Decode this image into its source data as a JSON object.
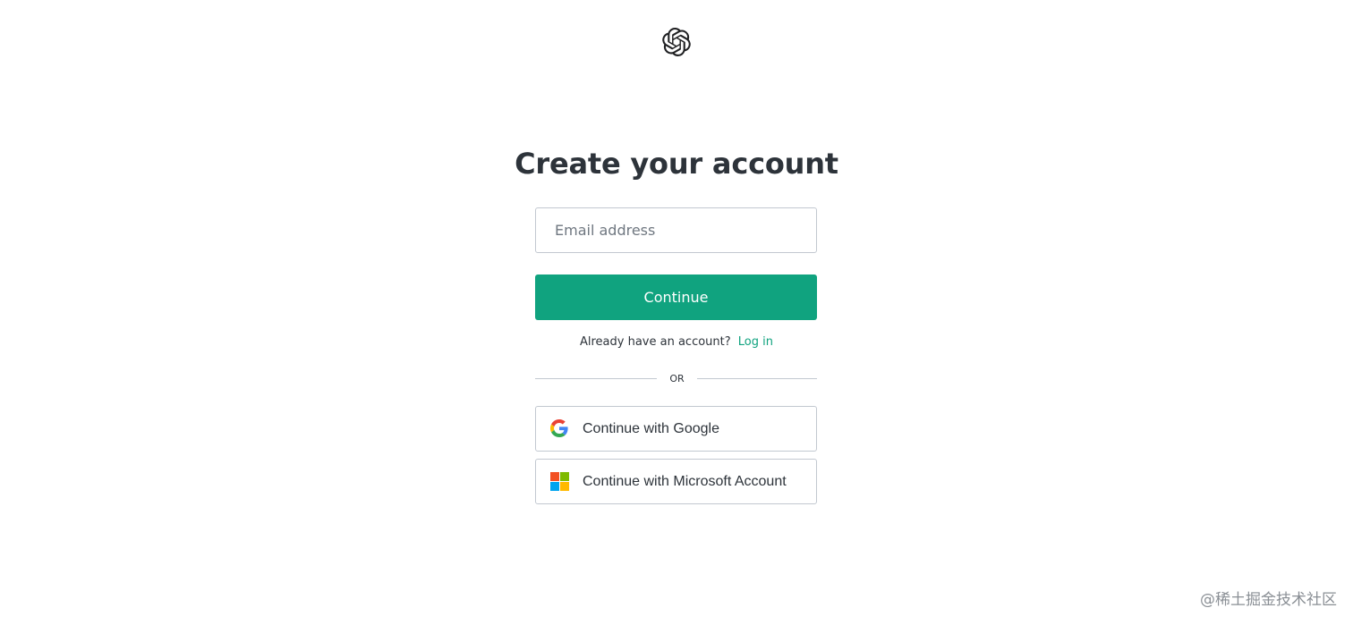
{
  "header": {
    "logo_icon": "openai-logo-icon"
  },
  "form": {
    "title": "Create your account",
    "email_placeholder": "Email address",
    "email_value": "",
    "continue_label": "Continue",
    "login_prompt": "Already have an account?",
    "login_link": "Log in",
    "divider_text": "OR"
  },
  "social": {
    "google_label": "Continue with Google",
    "google_icon": "google-icon",
    "microsoft_label": "Continue with Microsoft Account",
    "microsoft_icon": "microsoft-icon"
  },
  "watermark": {
    "text": "@稀土掘金技术社区"
  },
  "colors": {
    "accent": "#10a37f",
    "text": "#2d333a",
    "border": "#c2c8d0",
    "google_blue": "#4285f4",
    "google_red": "#ea4335",
    "google_yellow": "#fbbc05",
    "google_green": "#34a853",
    "ms_red": "#f25022",
    "ms_green": "#7fba00",
    "ms_blue": "#00a4ef",
    "ms_yellow": "#ffb900"
  }
}
